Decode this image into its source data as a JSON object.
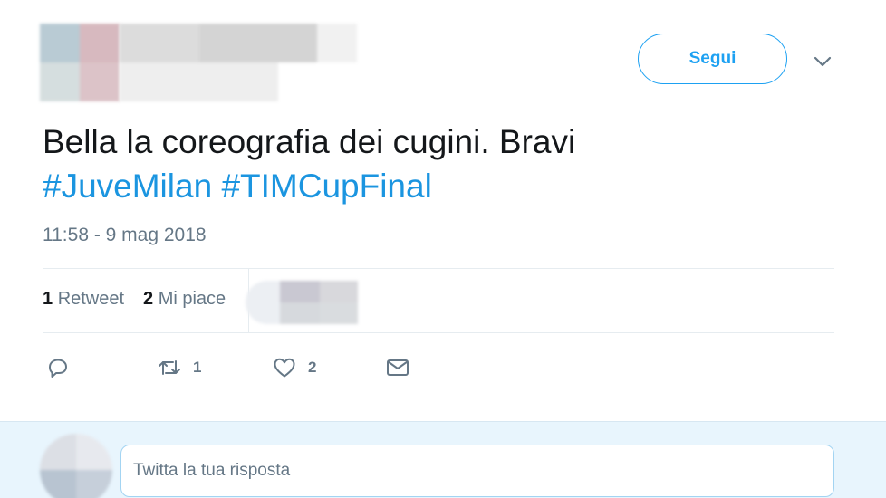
{
  "header": {
    "follow_label": "Segui",
    "caret_icon": "chevron-down-icon"
  },
  "tweet": {
    "text": "Bella la coreografia dei cugini. Bravi",
    "hashtags": [
      "#JuveMilan",
      "#TIMCupFinal"
    ],
    "timestamp": "11:58 - 9 mag 2018"
  },
  "stats": {
    "retweets_count": "1",
    "retweets_label": "Retweet",
    "likes_count": "2",
    "likes_label": "Mi piace"
  },
  "actions": {
    "reply_icon": "reply-icon",
    "retweet_icon": "retweet-icon",
    "retweet_count": "1",
    "like_icon": "heart-icon",
    "like_count": "2",
    "dm_icon": "envelope-icon"
  },
  "reply": {
    "placeholder": "Twitta la tua risposta"
  },
  "colors": {
    "accent": "#1da1f2",
    "hashtag": "#1b95e0",
    "muted": "#657786",
    "reply_bg": "#e8f5fd"
  }
}
